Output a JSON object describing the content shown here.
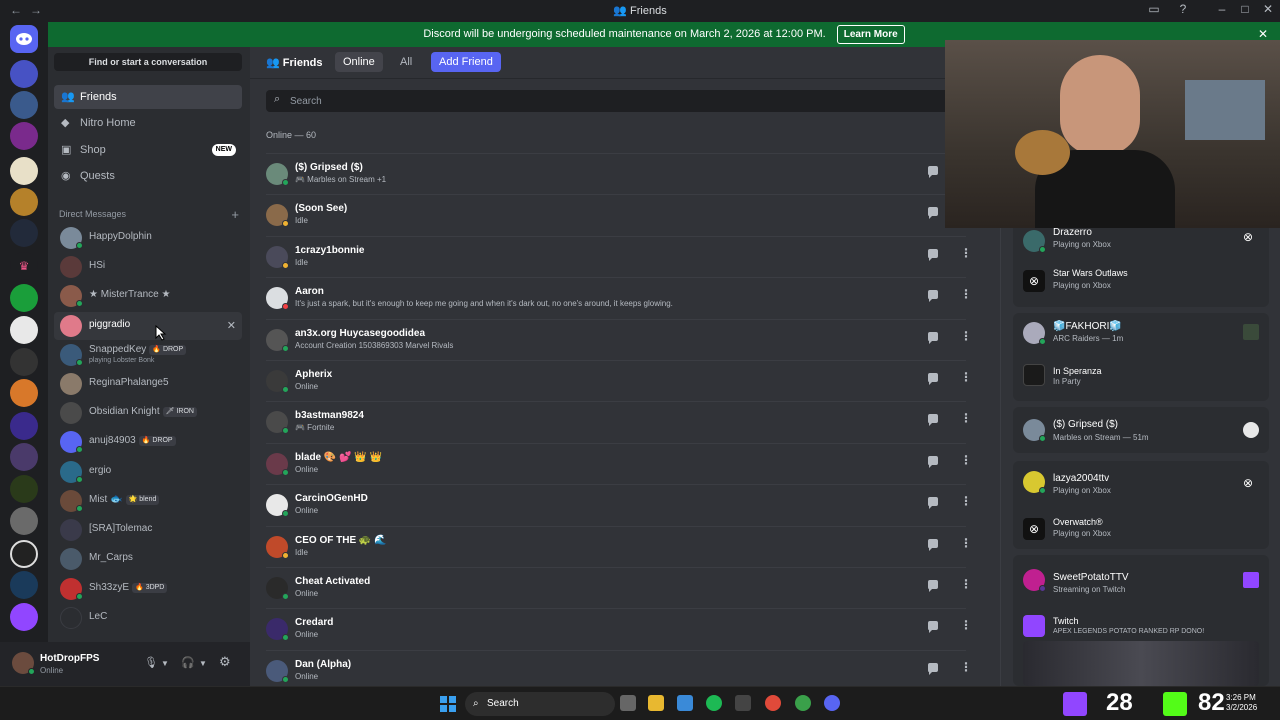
{
  "window": {
    "title": "Friends",
    "back": "←",
    "forward": "→"
  },
  "banner": {
    "text": "Discord will be undergoing scheduled maintenance on March 2, 2026 at 12:00 PM.",
    "button": "Learn More"
  },
  "sidebar": {
    "search_label": "Find or start a conversation",
    "nav": [
      {
        "label": "Friends",
        "icon": "friends-icon",
        "active": true
      },
      {
        "label": "Nitro Home",
        "icon": "nitro-icon"
      },
      {
        "label": "Shop",
        "icon": "shop-icon",
        "badge": "NEW"
      },
      {
        "label": "Quests",
        "icon": "quests-icon"
      }
    ],
    "dm_header": "Direct Messages",
    "dms": [
      {
        "name": "HappyDolphin"
      },
      {
        "name": "HSi"
      },
      {
        "name": "★ MisterTrance ★"
      },
      {
        "name": "piggradio"
      },
      {
        "name": "SnappedKey",
        "tag": "🔥 DROP",
        "sub": "playing Lobster Bonk"
      },
      {
        "name": "ReginaPhalange5"
      },
      {
        "name": "Obsidian Knight",
        "tag": "🗡 IRON"
      },
      {
        "name": "anuj84903",
        "tag": "🔥 DROP"
      },
      {
        "name": "ergio"
      },
      {
        "name": "Mist",
        "emoji": "🐟",
        "tag": "🌟 blend"
      },
      {
        "name": "[SRA]Tolemac"
      },
      {
        "name": "Mr_Carps"
      },
      {
        "name": "Sh33zyE",
        "tag": "🔥 3DPD"
      },
      {
        "name": "LeC"
      }
    ]
  },
  "user": {
    "name": "HotDropFPS",
    "status": "Online"
  },
  "main": {
    "title": "Friends",
    "tabs": [
      "Online",
      "All"
    ],
    "add_friend": "Add Friend",
    "search_placeholder": "Search",
    "online_count": "Online — 60",
    "friends": [
      {
        "name": "($) Gripsed ($)",
        "status": "🎮 Marbles on Stream +1",
        "state": "online"
      },
      {
        "name": "(Soon See)",
        "status": "Idle",
        "state": "idle"
      },
      {
        "name": "1crazy1bonnie",
        "status": "Idle",
        "state": "idle"
      },
      {
        "name": "Aaron",
        "status": "It's just a spark, but it's enough to keep me going and when it's dark out, no one's around, it keeps glowing.",
        "state": "dnd"
      },
      {
        "name": "an3x.org Huycasegoodidea",
        "status": "Account Creation 1503869303 Marvel Rivals",
        "state": "online"
      },
      {
        "name": "Apherix",
        "status": "Online",
        "state": "online"
      },
      {
        "name": "b3astman9824",
        "status": "🎮 Fortnite",
        "state": "online"
      },
      {
        "name": "blade 🎨 💕 👑 👑",
        "status": "Online",
        "state": "online"
      },
      {
        "name": "CarcinOGenHD",
        "status": "Online",
        "state": "online"
      },
      {
        "name": "CEO OF THE 🐢 🌊",
        "status": "Idle",
        "state": "idle"
      },
      {
        "name": "Cheat Activated",
        "status": "Online",
        "state": "online"
      },
      {
        "name": "Credard",
        "status": "Online",
        "state": "online"
      },
      {
        "name": "Dan (Alpha)",
        "status": "Online",
        "state": "online"
      }
    ]
  },
  "active_now": {
    "cards": [
      {
        "name": "Drazerro",
        "status": "Playing on Xbox",
        "game": "Star Wars Outlaws",
        "game_status": "Playing on Xbox"
      },
      {
        "name": "🧊FAKHORI🧊",
        "status": "ARC Raiders — 1m",
        "game": "In Speranza",
        "game_status": "In Party"
      },
      {
        "name": "($) Gripsed ($)",
        "status": "Marbles on Stream — 51m"
      },
      {
        "name": "lazya2004ttv",
        "status": "Playing on Xbox",
        "game": "Overwatch®",
        "game_status": "Playing on Xbox"
      },
      {
        "name": "SweetPotatoTTV",
        "status": "Streaming on Twitch",
        "game": "Twitch",
        "game_status": "APEX LEGENDS POTATO RANKED RP DONO!"
      }
    ]
  },
  "taskbar": {
    "search": "Search",
    "stat1": "28",
    "stat2": "82",
    "time": "3:26 PM",
    "date": "3/2/2026"
  },
  "colors": {
    "accent": "#5865f2",
    "online": "#23a55a",
    "idle": "#f0b232",
    "dnd": "#f23f43",
    "banner": "#0e6a30"
  }
}
